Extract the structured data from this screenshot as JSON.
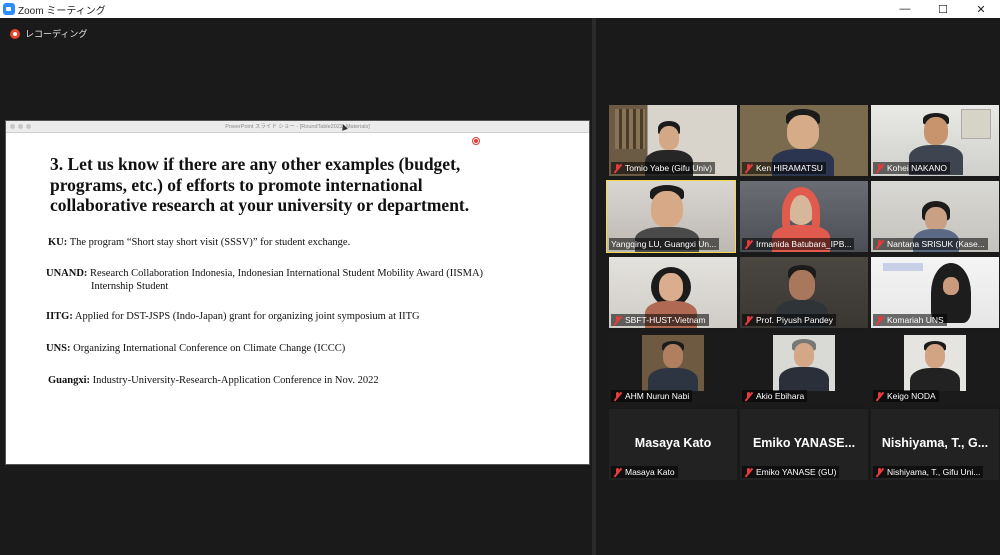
{
  "window": {
    "title": "Zoom ミーティング",
    "minimize_icon": "minimize-icon",
    "maximize_icon": "maximize-icon",
    "close_icon": "close-icon"
  },
  "recording": {
    "label": "レコーディング"
  },
  "share": {
    "window_title": "PowerPoint スライド ショー - [RoundTable2022_Materials]",
    "slide": {
      "heading_lines": [
        "3. Let us know if there are any other examples (budget,",
        "programs, etc.) of efforts to promote international",
        "collaborative research at your university or department."
      ],
      "items": [
        {
          "key": "KU:",
          "text": "The program “Short stay short visit (SSSV)” for student exchange."
        },
        {
          "key": "UNAND:",
          "text": "Research Collaboration Indonesia, Indonesian International Student Mobility Award (IISMA)",
          "text2": "Internship Student"
        },
        {
          "key": "IITG:",
          "text": "Applied for DST-JSPS (Indo-Japan) grant for organizing joint symposium at IITG"
        },
        {
          "key": "UNS:",
          "text": "Organizing International Conference on Climate Change (ICCC)"
        },
        {
          "key": "Guangxi:",
          "text": "Industry-University-Research-Application Conference in Nov. 2022"
        }
      ]
    }
  },
  "participants": [
    {
      "name": "Tomio Yabe (Gifu Univ)",
      "muted": true,
      "video": true
    },
    {
      "name": "Ken HIRAMATSU",
      "muted": true,
      "video": true
    },
    {
      "name": "Kohei NAKANO",
      "muted": true,
      "video": true
    },
    {
      "name": "Yangqing LU, Guangxi Un...",
      "muted": false,
      "video": true,
      "active_speaker": true
    },
    {
      "name": "Irmanida Batubara_IPB...",
      "muted": true,
      "video": true
    },
    {
      "name": "Nantana SRISUK (Kase...",
      "muted": true,
      "video": true
    },
    {
      "name": "SBFT-HUST-Vietnam",
      "muted": true,
      "video": true
    },
    {
      "name": "Prof. Piyush Pandey",
      "muted": true,
      "video": true
    },
    {
      "name": "Komariah UNS",
      "muted": true,
      "video": true
    },
    {
      "name": "AHM Nurun Nabi",
      "muted": true,
      "video": true
    },
    {
      "name": "Akio Ebihara",
      "muted": true,
      "video": true
    },
    {
      "name": "Keigo NODA",
      "muted": true,
      "video": true
    },
    {
      "name": "Masaya Kato",
      "big_name": "Masaya Kato",
      "muted": true,
      "video": false
    },
    {
      "name": "Emiko YANASE (GU)",
      "big_name": "Emiko  YANASE...",
      "muted": true,
      "video": false
    },
    {
      "name": "Nishiyama, T., Gifu Uni...",
      "big_name": "Nishiyama, T., G...",
      "muted": true,
      "video": false
    }
  ]
}
